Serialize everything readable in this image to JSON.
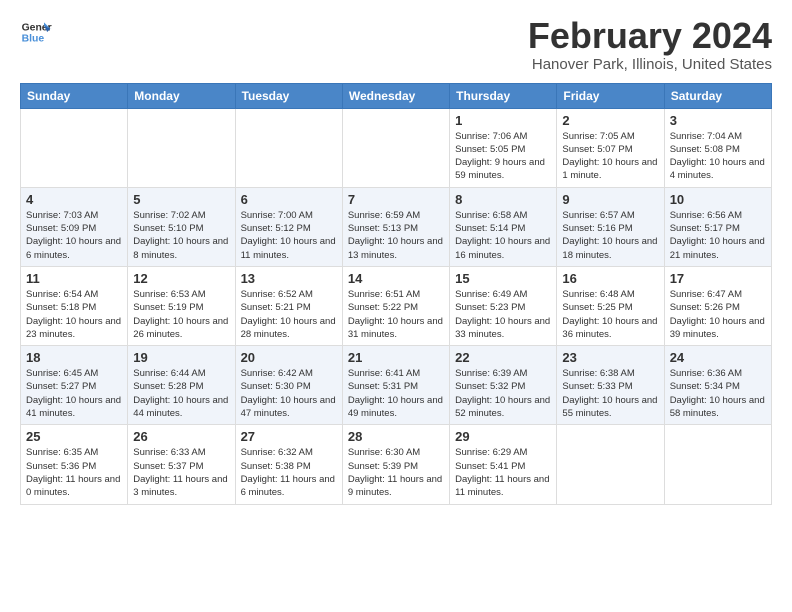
{
  "logo": {
    "line1": "General",
    "line2": "Blue"
  },
  "title": "February 2024",
  "location": "Hanover Park, Illinois, United States",
  "weekdays": [
    "Sunday",
    "Monday",
    "Tuesday",
    "Wednesday",
    "Thursday",
    "Friday",
    "Saturday"
  ],
  "weeks": [
    [
      {
        "day": "",
        "info": ""
      },
      {
        "day": "",
        "info": ""
      },
      {
        "day": "",
        "info": ""
      },
      {
        "day": "",
        "info": ""
      },
      {
        "day": "1",
        "info": "Sunrise: 7:06 AM\nSunset: 5:05 PM\nDaylight: 9 hours and 59 minutes."
      },
      {
        "day": "2",
        "info": "Sunrise: 7:05 AM\nSunset: 5:07 PM\nDaylight: 10 hours and 1 minute."
      },
      {
        "day": "3",
        "info": "Sunrise: 7:04 AM\nSunset: 5:08 PM\nDaylight: 10 hours and 4 minutes."
      }
    ],
    [
      {
        "day": "4",
        "info": "Sunrise: 7:03 AM\nSunset: 5:09 PM\nDaylight: 10 hours and 6 minutes."
      },
      {
        "day": "5",
        "info": "Sunrise: 7:02 AM\nSunset: 5:10 PM\nDaylight: 10 hours and 8 minutes."
      },
      {
        "day": "6",
        "info": "Sunrise: 7:00 AM\nSunset: 5:12 PM\nDaylight: 10 hours and 11 minutes."
      },
      {
        "day": "7",
        "info": "Sunrise: 6:59 AM\nSunset: 5:13 PM\nDaylight: 10 hours and 13 minutes."
      },
      {
        "day": "8",
        "info": "Sunrise: 6:58 AM\nSunset: 5:14 PM\nDaylight: 10 hours and 16 minutes."
      },
      {
        "day": "9",
        "info": "Sunrise: 6:57 AM\nSunset: 5:16 PM\nDaylight: 10 hours and 18 minutes."
      },
      {
        "day": "10",
        "info": "Sunrise: 6:56 AM\nSunset: 5:17 PM\nDaylight: 10 hours and 21 minutes."
      }
    ],
    [
      {
        "day": "11",
        "info": "Sunrise: 6:54 AM\nSunset: 5:18 PM\nDaylight: 10 hours and 23 minutes."
      },
      {
        "day": "12",
        "info": "Sunrise: 6:53 AM\nSunset: 5:19 PM\nDaylight: 10 hours and 26 minutes."
      },
      {
        "day": "13",
        "info": "Sunrise: 6:52 AM\nSunset: 5:21 PM\nDaylight: 10 hours and 28 minutes."
      },
      {
        "day": "14",
        "info": "Sunrise: 6:51 AM\nSunset: 5:22 PM\nDaylight: 10 hours and 31 minutes."
      },
      {
        "day": "15",
        "info": "Sunrise: 6:49 AM\nSunset: 5:23 PM\nDaylight: 10 hours and 33 minutes."
      },
      {
        "day": "16",
        "info": "Sunrise: 6:48 AM\nSunset: 5:25 PM\nDaylight: 10 hours and 36 minutes."
      },
      {
        "day": "17",
        "info": "Sunrise: 6:47 AM\nSunset: 5:26 PM\nDaylight: 10 hours and 39 minutes."
      }
    ],
    [
      {
        "day": "18",
        "info": "Sunrise: 6:45 AM\nSunset: 5:27 PM\nDaylight: 10 hours and 41 minutes."
      },
      {
        "day": "19",
        "info": "Sunrise: 6:44 AM\nSunset: 5:28 PM\nDaylight: 10 hours and 44 minutes."
      },
      {
        "day": "20",
        "info": "Sunrise: 6:42 AM\nSunset: 5:30 PM\nDaylight: 10 hours and 47 minutes."
      },
      {
        "day": "21",
        "info": "Sunrise: 6:41 AM\nSunset: 5:31 PM\nDaylight: 10 hours and 49 minutes."
      },
      {
        "day": "22",
        "info": "Sunrise: 6:39 AM\nSunset: 5:32 PM\nDaylight: 10 hours and 52 minutes."
      },
      {
        "day": "23",
        "info": "Sunrise: 6:38 AM\nSunset: 5:33 PM\nDaylight: 10 hours and 55 minutes."
      },
      {
        "day": "24",
        "info": "Sunrise: 6:36 AM\nSunset: 5:34 PM\nDaylight: 10 hours and 58 minutes."
      }
    ],
    [
      {
        "day": "25",
        "info": "Sunrise: 6:35 AM\nSunset: 5:36 PM\nDaylight: 11 hours and 0 minutes."
      },
      {
        "day": "26",
        "info": "Sunrise: 6:33 AM\nSunset: 5:37 PM\nDaylight: 11 hours and 3 minutes."
      },
      {
        "day": "27",
        "info": "Sunrise: 6:32 AM\nSunset: 5:38 PM\nDaylight: 11 hours and 6 minutes."
      },
      {
        "day": "28",
        "info": "Sunrise: 6:30 AM\nSunset: 5:39 PM\nDaylight: 11 hours and 9 minutes."
      },
      {
        "day": "29",
        "info": "Sunrise: 6:29 AM\nSunset: 5:41 PM\nDaylight: 11 hours and 11 minutes."
      },
      {
        "day": "",
        "info": ""
      },
      {
        "day": "",
        "info": ""
      }
    ]
  ]
}
